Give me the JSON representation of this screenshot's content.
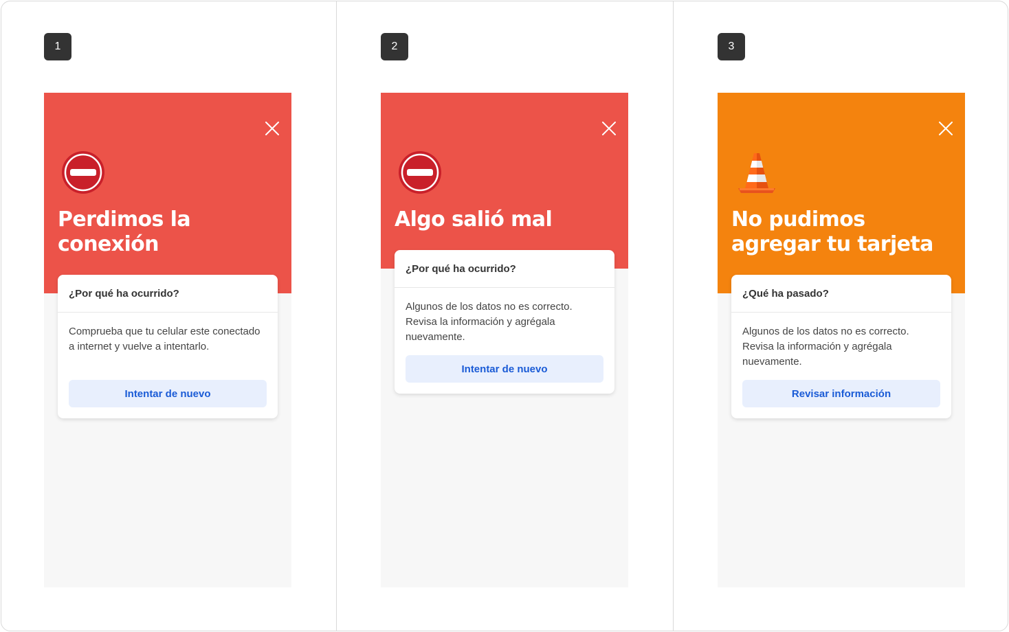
{
  "colors": {
    "red": "#ec5349",
    "orange": "#f4830e",
    "button_bg": "#e8effd",
    "button_text": "#1a5bd6",
    "badge": "#333333"
  },
  "panels": [
    {
      "number": "1",
      "theme": "red",
      "icon": "no-entry-icon",
      "title": "Perdimos la conexión",
      "question": "¿Por qué ha ocurrido?",
      "message": "Comprueba que tu celular este conectado a internet y vuelve a intentarlo.",
      "button": "Intentar de nuevo"
    },
    {
      "number": "2",
      "theme": "red",
      "icon": "no-entry-icon",
      "title": "Algo salió mal",
      "question": "¿Por qué ha ocurrido?",
      "message": "Algunos de los datos no es correcto. Revisa la información y agrégala nuevamente.",
      "button": "Intentar de nuevo"
    },
    {
      "number": "3",
      "theme": "orange",
      "icon": "traffic-cone-icon",
      "title": "No pudimos agregar tu tarjeta",
      "question": "¿Qué ha pasado?",
      "message": "Algunos de los datos no es correcto. Revisa la información y agrégala nuevamente.",
      "button": "Revisar información"
    }
  ]
}
